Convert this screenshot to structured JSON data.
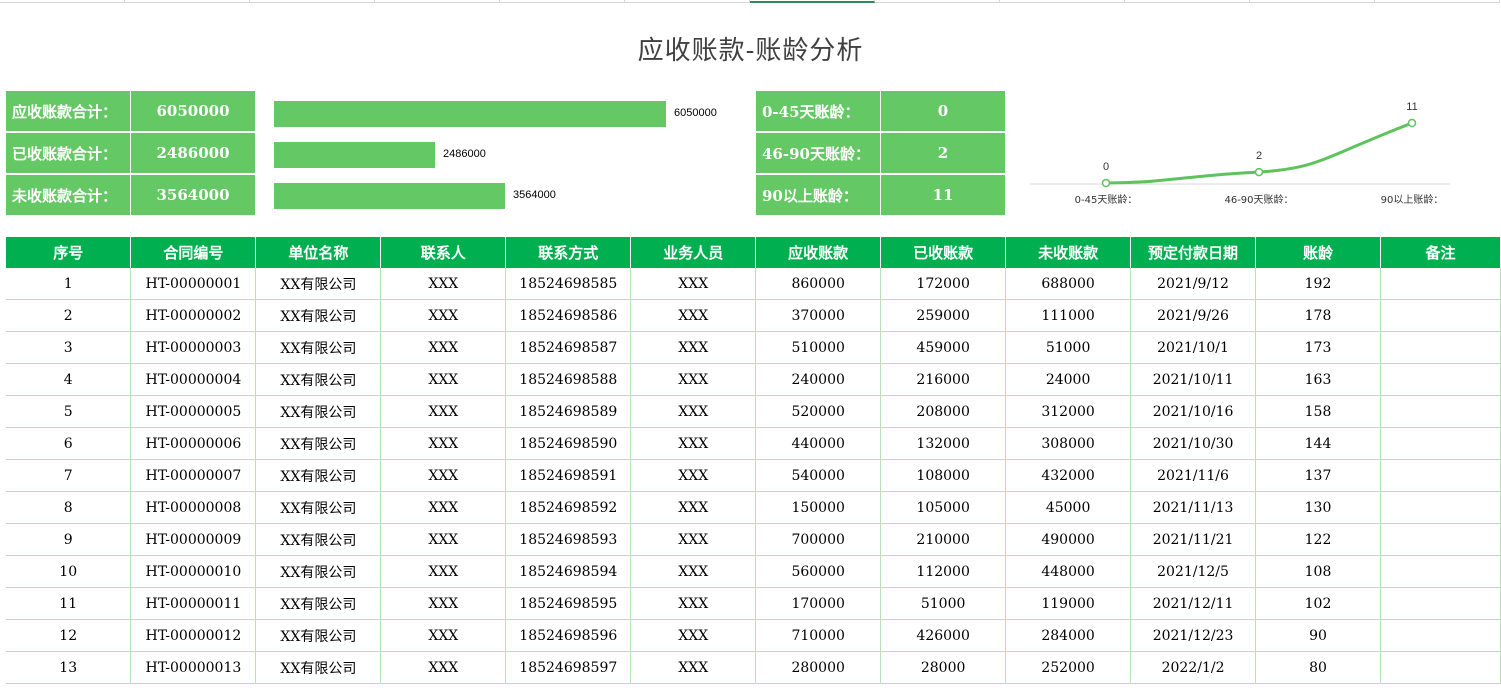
{
  "title": "应收账款-账龄分析",
  "colors": {
    "green": "#64c864",
    "header_green": "#00b050",
    "line_green": "#5ec25e"
  },
  "summary": [
    {
      "label": "应收账款合计：",
      "value": "6050000"
    },
    {
      "label": "已收账款合计：",
      "value": "2486000"
    },
    {
      "label": "未收账款合计：",
      "value": "3564000"
    }
  ],
  "aging": [
    {
      "label": "0-45天账龄：",
      "value": "0"
    },
    {
      "label": "46-90天账龄：",
      "value": "2"
    },
    {
      "label": "90以上账龄：",
      "value": "11"
    }
  ],
  "chart_data": [
    {
      "type": "bar",
      "orientation": "horizontal",
      "categories": [
        "应收账款合计：",
        "已收账款合计：",
        "未收账款合计："
      ],
      "values": [
        6050000,
        2486000,
        3564000
      ],
      "data_labels": [
        "6050000",
        "2486000",
        "3564000"
      ],
      "xlim": [
        0,
        6050000
      ]
    },
    {
      "type": "line",
      "categories": [
        "0-45天账龄：",
        "46-90天账龄：",
        "90以上账龄："
      ],
      "values": [
        0,
        2,
        11
      ],
      "data_labels": [
        "0",
        "2",
        "11"
      ],
      "ylim": [
        0,
        11
      ],
      "smooth": true
    }
  ],
  "table": {
    "headers": [
      "序号",
      "合同编号",
      "单位名称",
      "联系人",
      "联系方式",
      "业务人员",
      "应收账款",
      "已收账款",
      "未收账款",
      "预定付款日期",
      "账龄",
      "备注"
    ],
    "rows": [
      [
        "1",
        "HT-00000001",
        "XX有限公司",
        "XXX",
        "18524698585",
        "XXX",
        "860000",
        "172000",
        "688000",
        "2021/9/12",
        "192",
        ""
      ],
      [
        "2",
        "HT-00000002",
        "XX有限公司",
        "XXX",
        "18524698586",
        "XXX",
        "370000",
        "259000",
        "111000",
        "2021/9/26",
        "178",
        ""
      ],
      [
        "3",
        "HT-00000003",
        "XX有限公司",
        "XXX",
        "18524698587",
        "XXX",
        "510000",
        "459000",
        "51000",
        "2021/10/1",
        "173",
        ""
      ],
      [
        "4",
        "HT-00000004",
        "XX有限公司",
        "XXX",
        "18524698588",
        "XXX",
        "240000",
        "216000",
        "24000",
        "2021/10/11",
        "163",
        ""
      ],
      [
        "5",
        "HT-00000005",
        "XX有限公司",
        "XXX",
        "18524698589",
        "XXX",
        "520000",
        "208000",
        "312000",
        "2021/10/16",
        "158",
        ""
      ],
      [
        "6",
        "HT-00000006",
        "XX有限公司",
        "XXX",
        "18524698590",
        "XXX",
        "440000",
        "132000",
        "308000",
        "2021/10/30",
        "144",
        ""
      ],
      [
        "7",
        "HT-00000007",
        "XX有限公司",
        "XXX",
        "18524698591",
        "XXX",
        "540000",
        "108000",
        "432000",
        "2021/11/6",
        "137",
        ""
      ],
      [
        "8",
        "HT-00000008",
        "XX有限公司",
        "XXX",
        "18524698592",
        "XXX",
        "150000",
        "105000",
        "45000",
        "2021/11/13",
        "130",
        ""
      ],
      [
        "9",
        "HT-00000009",
        "XX有限公司",
        "XXX",
        "18524698593",
        "XXX",
        "700000",
        "210000",
        "490000",
        "2021/11/21",
        "122",
        ""
      ],
      [
        "10",
        "HT-00000010",
        "XX有限公司",
        "XXX",
        "18524698594",
        "XXX",
        "560000",
        "112000",
        "448000",
        "2021/12/5",
        "108",
        ""
      ],
      [
        "11",
        "HT-00000011",
        "XX有限公司",
        "XXX",
        "18524698595",
        "XXX",
        "170000",
        "51000",
        "119000",
        "2021/12/11",
        "102",
        ""
      ],
      [
        "12",
        "HT-00000012",
        "XX有限公司",
        "XXX",
        "18524698596",
        "XXX",
        "710000",
        "426000",
        "284000",
        "2021/12/23",
        "90",
        ""
      ],
      [
        "13",
        "HT-00000013",
        "XX有限公司",
        "XXX",
        "18524698597",
        "XXX",
        "280000",
        "28000",
        "252000",
        "2022/1/2",
        "80",
        ""
      ]
    ]
  }
}
